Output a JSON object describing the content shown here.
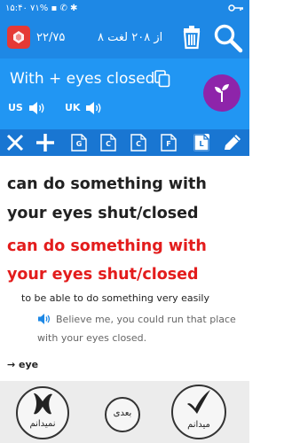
{
  "status": {
    "time": "۱۵:۴۰",
    "battery": "۷۱%",
    "indicators": "▪ ✆ ✱"
  },
  "header": {
    "score": "۲۲/۷۵",
    "counter": "۸ از ۲۰۸ لغت"
  },
  "word": {
    "title": "With + eyes closed",
    "us_label": "US",
    "uk_label": "UK"
  },
  "toolbar": {
    "files": [
      "G",
      "C",
      "C",
      "F",
      "L"
    ]
  },
  "content": {
    "phrase": "can do something with your eyes shut/closed",
    "phrase_highlight": "can do something with your eyes shut/closed",
    "definition": "to be able to do something very easily",
    "example": "Believe me, you could run that place with your eyes closed.",
    "related": "→ eye"
  },
  "actions": {
    "dont_know": "نمیدانم",
    "next": "بعدی",
    "know": "میدانم"
  },
  "colors": {
    "header_blue": "#1E88E5",
    "word_bar_blue": "#2196F3",
    "toolbar_blue": "#1976D2",
    "highlight_red": "#E31C1C",
    "ruby_red": "#E53935",
    "plant_purple": "#8E24AA"
  }
}
